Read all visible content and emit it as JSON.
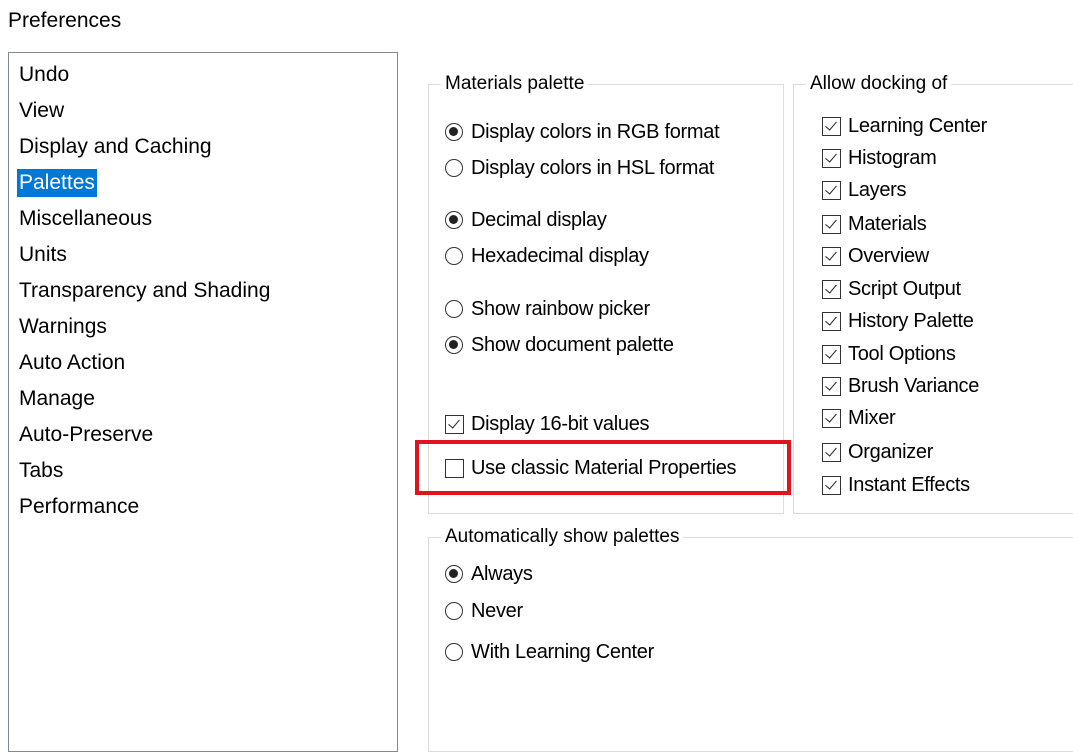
{
  "window": {
    "title": "Preferences"
  },
  "categories": [
    {
      "label": "Undo",
      "selected": false
    },
    {
      "label": "View",
      "selected": false
    },
    {
      "label": "Display and Caching",
      "selected": false
    },
    {
      "label": "Palettes",
      "selected": true
    },
    {
      "label": "Miscellaneous",
      "selected": false
    },
    {
      "label": "Units",
      "selected": false
    },
    {
      "label": "Transparency and Shading",
      "selected": false
    },
    {
      "label": "Warnings",
      "selected": false
    },
    {
      "label": "Auto Action",
      "selected": false
    },
    {
      "label": "Manage",
      "selected": false
    },
    {
      "label": "Auto-Preserve",
      "selected": false
    },
    {
      "label": "Tabs",
      "selected": false
    },
    {
      "label": "Performance",
      "selected": false
    }
  ],
  "materials_palette": {
    "label": "Materials palette",
    "color_format": [
      {
        "label": "Display colors in RGB format",
        "selected": true
      },
      {
        "label": "Display colors in HSL format",
        "selected": false
      }
    ],
    "number_display": [
      {
        "label": "Decimal display",
        "selected": true
      },
      {
        "label": "Hexadecimal display",
        "selected": false
      }
    ],
    "picker": [
      {
        "label": "Show rainbow picker",
        "selected": false
      },
      {
        "label": "Show document palette",
        "selected": true
      }
    ],
    "display_16bit": {
      "label": "Display 16-bit values",
      "checked": true
    },
    "classic_properties": {
      "label": "Use classic Material Properties",
      "checked": false
    }
  },
  "docking": {
    "label": "Allow docking of",
    "items": [
      {
        "label": "Learning Center",
        "checked": true
      },
      {
        "label": "Histogram",
        "checked": true
      },
      {
        "label": "Layers",
        "checked": true
      },
      {
        "label": "Materials",
        "checked": true
      },
      {
        "label": "Overview",
        "checked": true
      },
      {
        "label": "Script Output",
        "checked": true
      },
      {
        "label": "History Palette",
        "checked": true
      },
      {
        "label": "Tool Options",
        "checked": true
      },
      {
        "label": "Brush Variance",
        "checked": true
      },
      {
        "label": "Mixer",
        "checked": true
      },
      {
        "label": "Organizer",
        "checked": true
      },
      {
        "label": "Instant Effects",
        "checked": true
      }
    ]
  },
  "auto_show": {
    "label": "Automatically show palettes",
    "options": [
      {
        "label": "Always",
        "selected": true
      },
      {
        "label": "Never",
        "selected": false
      },
      {
        "label": "With Learning Center",
        "selected": false
      }
    ]
  },
  "colors": {
    "selection": "#0078d7",
    "highlight": "#e0141c"
  }
}
